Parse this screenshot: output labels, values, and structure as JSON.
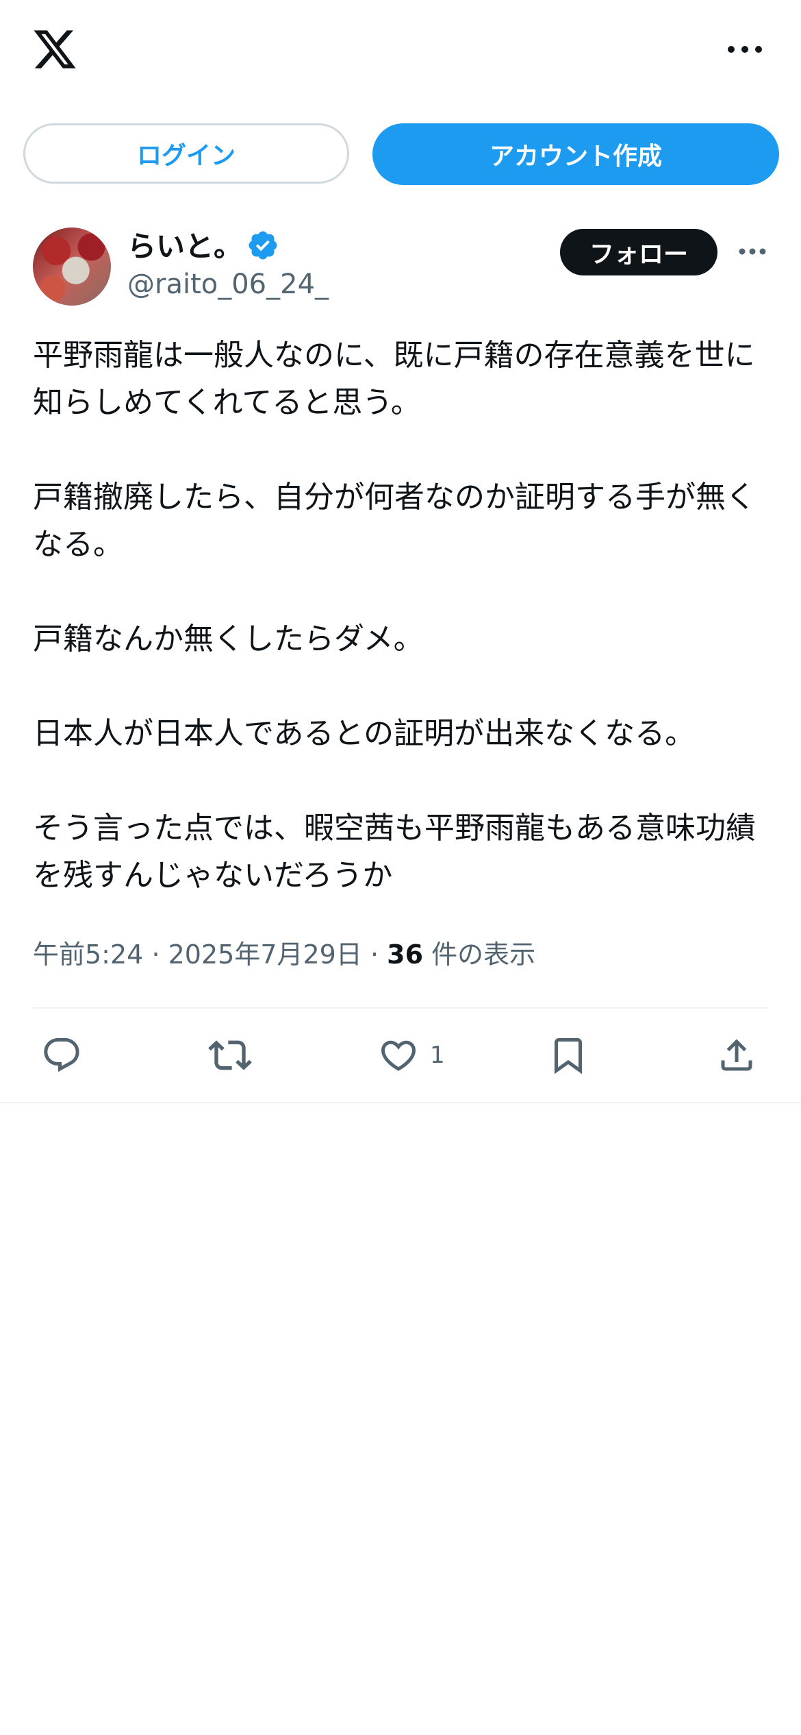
{
  "header": {
    "login_label": "ログイン",
    "signup_label": "アカウント作成"
  },
  "tweet": {
    "display_name": "らいと。",
    "handle": "@raito_06_24_",
    "follow_label": "フォロー",
    "paragraphs": [
      "平野雨龍は一般人なのに、既に戸籍の存在意義を世に知らしめてくれてると思う。",
      "戸籍撤廃したら、自分が何者なのか証明する手が無くなる。",
      "戸籍なんか無くしたらダメ。",
      "日本人が日本人であるとの証明が出来なくなる。",
      "そう言った点では、暇空茜も平野雨龍もある意味功績を残すんじゃないだろうか"
    ],
    "time": "午前5:24",
    "separator": "·",
    "date": "2025年7月29日",
    "views_count": "36",
    "views_label": "件の表示",
    "like_count": "1"
  },
  "icons": {
    "logo": "x-logo-icon",
    "more": "more-horizontal-icon",
    "verified": "verified-badge-icon",
    "reply": "reply-icon",
    "retweet": "retweet-icon",
    "like": "heart-icon",
    "bookmark": "bookmark-icon",
    "share": "share-icon"
  },
  "colors": {
    "accent": "#1d9bf0",
    "text": "#0f1419",
    "secondary": "#536471",
    "border": "#cfd9de"
  }
}
